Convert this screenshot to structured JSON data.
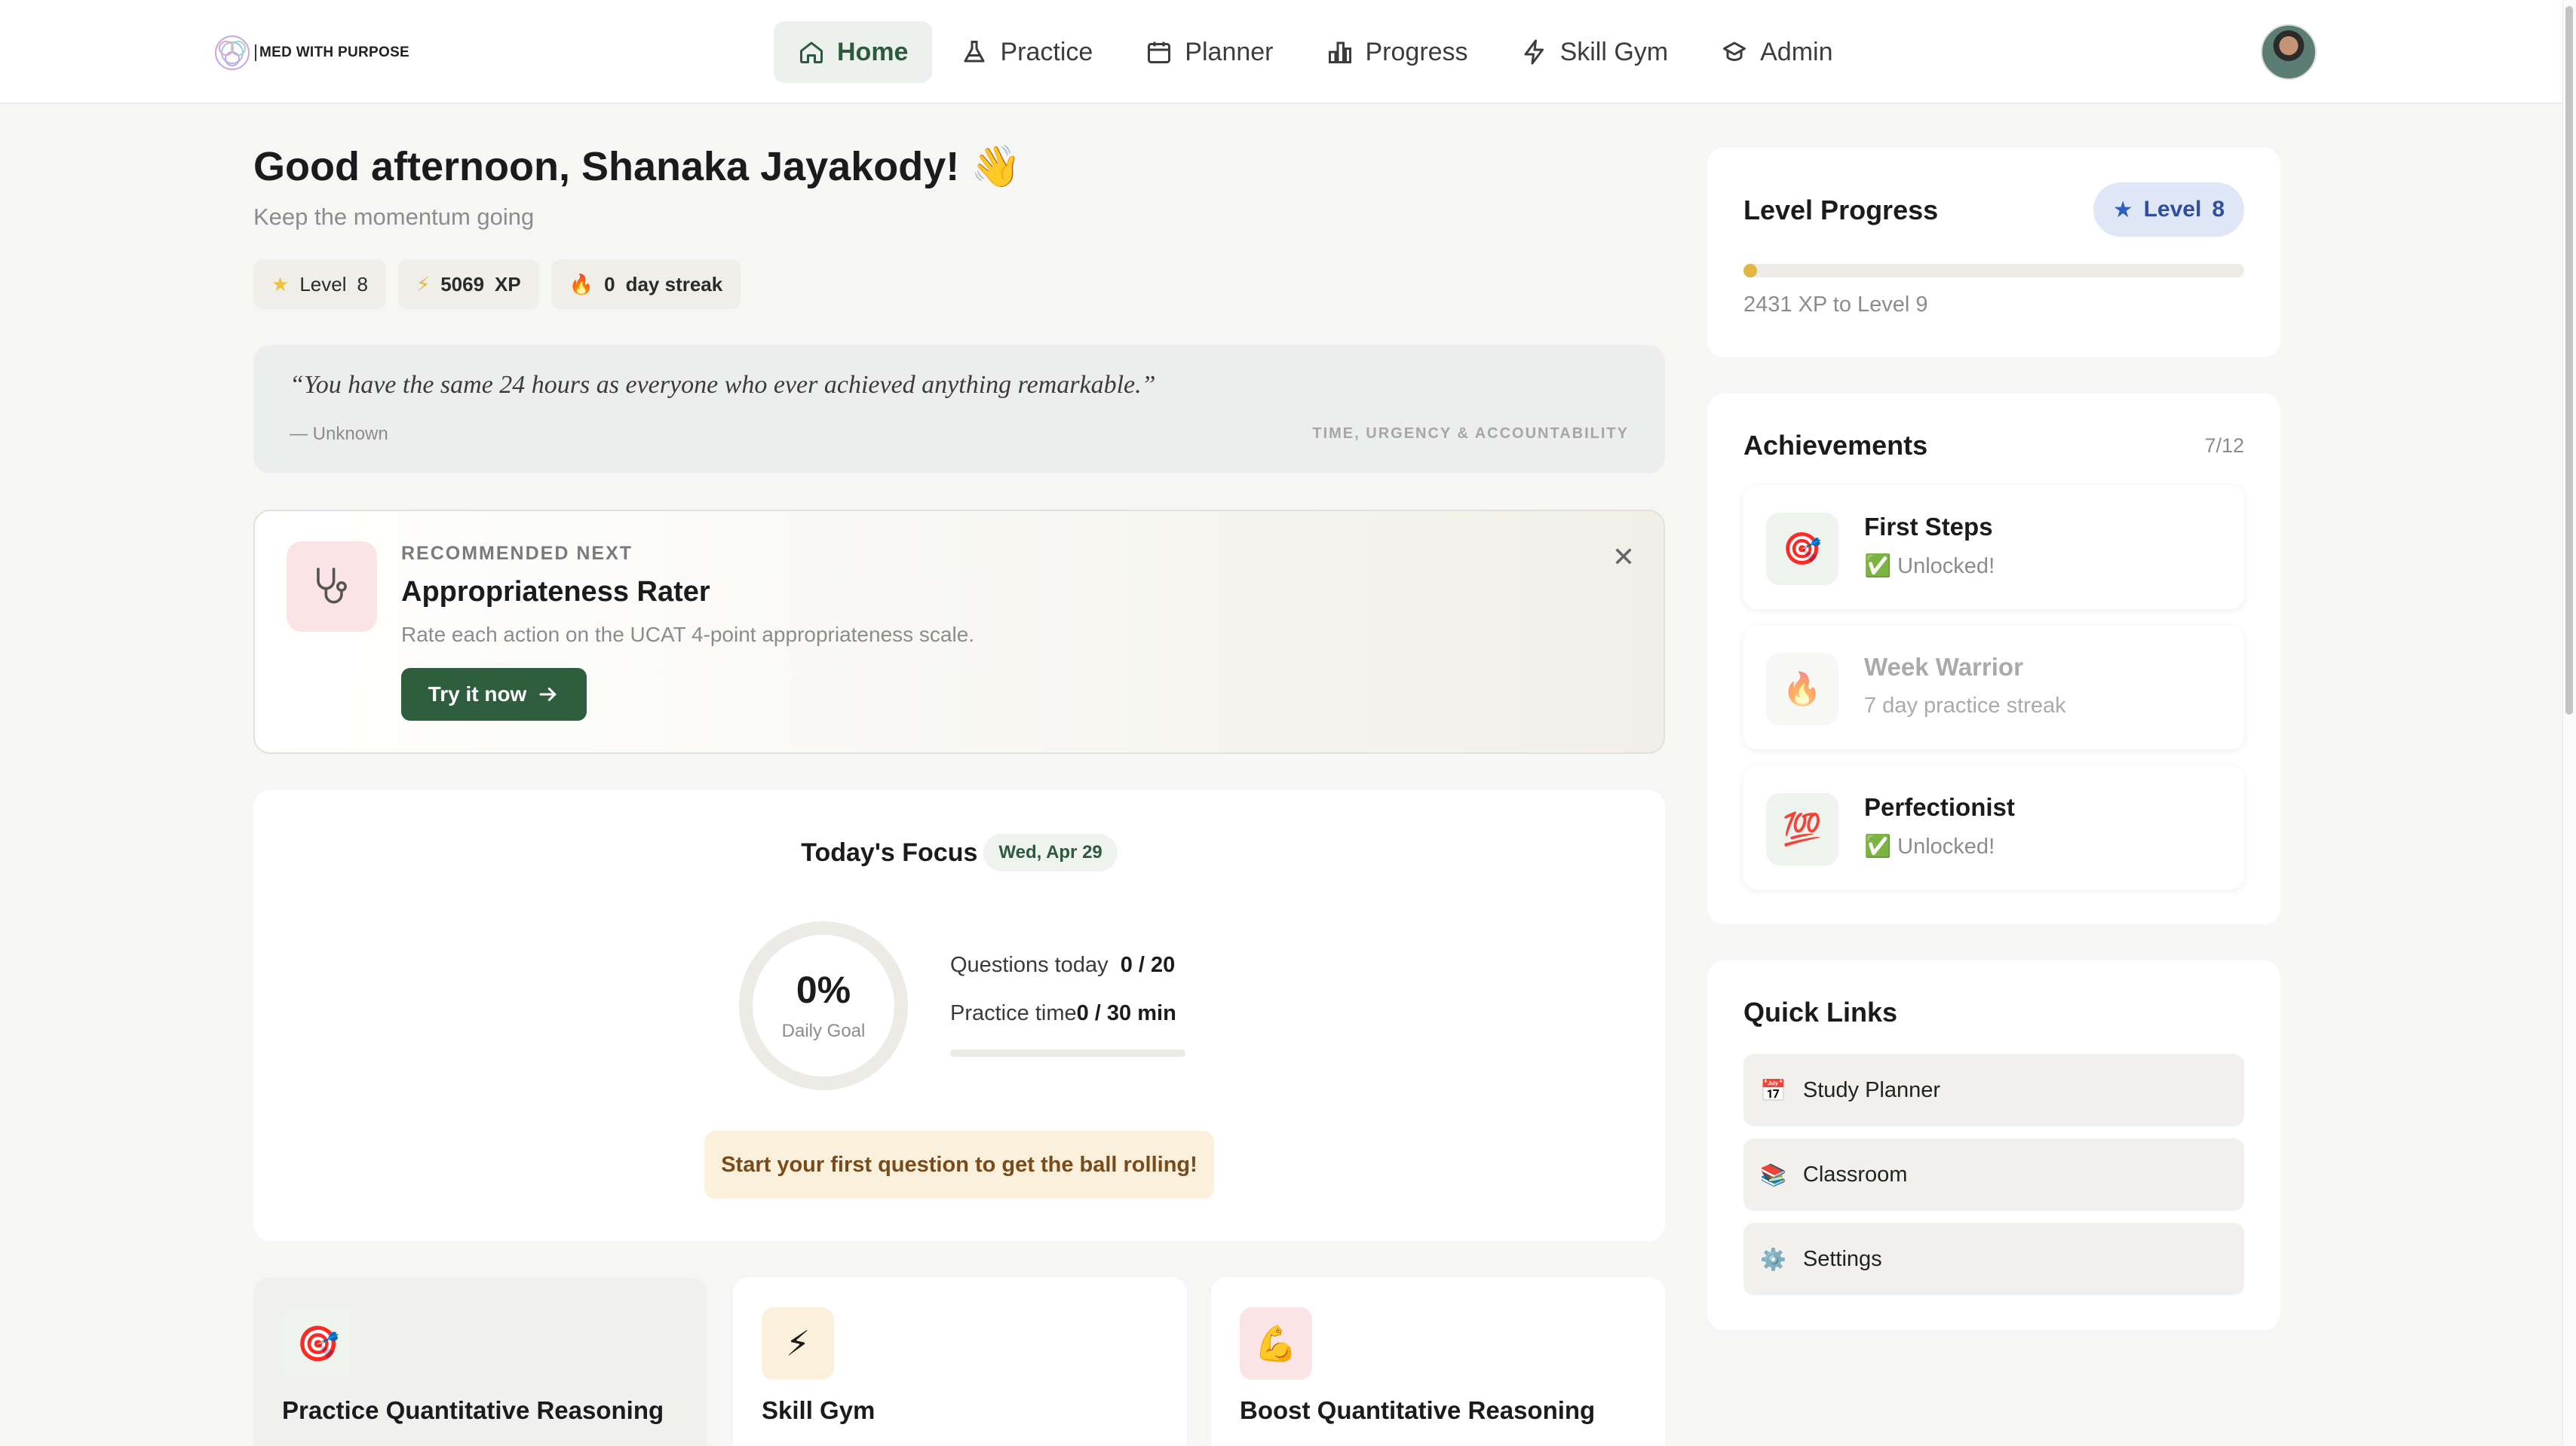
{
  "brand": {
    "name": "MED WITH PURPOSE"
  },
  "nav": {
    "items": [
      {
        "label": "Home",
        "icon": "home-icon",
        "active": true
      },
      {
        "label": "Practice",
        "icon": "flask-icon"
      },
      {
        "label": "Planner",
        "icon": "calendar-icon"
      },
      {
        "label": "Progress",
        "icon": "bar-chart-icon"
      },
      {
        "label": "Skill Gym",
        "icon": "lightning-icon"
      },
      {
        "label": "Admin",
        "icon": "graduation-cap-icon"
      }
    ]
  },
  "greeting": {
    "title": "Good afternoon, Shanaka Jayakody! 👋",
    "subtitle": "Keep the momentum going"
  },
  "stats_chips": {
    "level": {
      "label": "Level",
      "value": "8"
    },
    "xp": {
      "value": "5069",
      "label": "XP"
    },
    "streak": {
      "value": "0",
      "label": "day streak"
    }
  },
  "quote": {
    "text": "“You have the same 24 hours as everyone who ever achieved anything remarkable.”",
    "author": "— Unknown",
    "category": "TIME, URGENCY & ACCOUNTABILITY"
  },
  "recommended": {
    "kicker": "RECOMMENDED NEXT",
    "title": "Appropriateness Rater",
    "description": "Rate each action on the UCAT 4-point appropriateness scale.",
    "button": "Try it now",
    "close": "✕"
  },
  "focus": {
    "title": "Today's Focus",
    "date": "Wed, Apr 29",
    "percent": "0%",
    "ring_label": "Daily Goal",
    "progress_fraction": 0,
    "questions_label": "Questions today",
    "questions_value": "0 / 20",
    "time_label": "Practice time",
    "time_value": "0 / 30 min",
    "nudge": "Start your first question to get the ball rolling!"
  },
  "tiles": [
    {
      "title": "Practice Quantitative Reasoning",
      "icon": "🎯",
      "bg": "#eef3ee"
    },
    {
      "title": "Skill Gym",
      "icon": "⚡",
      "bg": "#fbf0dc"
    },
    {
      "title": "Boost Quantitative Reasoning",
      "icon": "💪",
      "bg": "#fbe4e6"
    }
  ],
  "level_progress": {
    "title": "Level Progress",
    "badge_label": "Level",
    "badge_value": "8",
    "fraction": 0.02,
    "caption": "2431 XP to Level 9"
  },
  "achievements": {
    "title": "Achievements",
    "count": "7/12",
    "items": [
      {
        "name": "First Steps",
        "status": "✅ Unlocked!",
        "icon": "🎯",
        "locked": false
      },
      {
        "name": "Week Warrior",
        "status": "7 day practice streak",
        "icon": "🔥",
        "locked": true
      },
      {
        "name": "Perfectionist",
        "status": "✅ Unlocked!",
        "icon": "💯",
        "locked": false
      }
    ]
  },
  "quick_links": {
    "title": "Quick Links",
    "items": [
      {
        "label": "Study Planner",
        "icon": "📅"
      },
      {
        "label": "Classroom",
        "icon": "📚"
      },
      {
        "label": "Settings",
        "icon": "⚙️"
      }
    ]
  },
  "colors": {
    "accent": "#2f5e3e",
    "level_badge": "#2f4f9c",
    "xp_gold": "#e0b740"
  }
}
